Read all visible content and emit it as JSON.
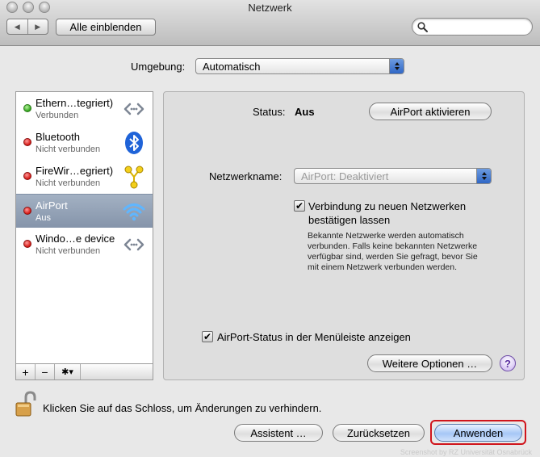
{
  "window": {
    "title": "Netzwerk"
  },
  "toolbar": {
    "back_icon": "back-arrow-icon",
    "forward_icon": "forward-arrow-icon",
    "show_all_label": "Alle einblenden",
    "search_placeholder": ""
  },
  "location": {
    "label": "Umgebung:",
    "value": "Automatisch"
  },
  "services": [
    {
      "name": "Ethern…tegriert)",
      "status": "Verbunden",
      "status_color": "#2da117",
      "icon": "ethernet-icon"
    },
    {
      "name": "Bluetooth",
      "status": "Nicht verbunden",
      "status_color": "#d3140f",
      "icon": "bluetooth-icon"
    },
    {
      "name": "FireWir…egriert)",
      "status": "Nicht verbunden",
      "status_color": "#d3140f",
      "icon": "firewire-icon"
    },
    {
      "name": "AirPort",
      "status": "Aus",
      "status_color": "#d3140f",
      "icon": "wifi-icon",
      "selected": true
    },
    {
      "name": "Windo…e device",
      "status": "Nicht verbunden",
      "status_color": "#d3140f",
      "icon": "ethernet-icon"
    }
  ],
  "listbar": {
    "add": "+",
    "remove": "−",
    "gear": "✱▾"
  },
  "detail": {
    "status_label": "Status:",
    "status_value": "Aus",
    "airport_button": "AirPort aktivieren",
    "network_name_label": "Netzwerkname:",
    "network_name_value": "AirPort: Deaktiviert",
    "confirm_checkbox_label_line1": "Verbindung zu neuen Netzwerken",
    "confirm_checkbox_label_line2": "bestätigen lassen",
    "confirm_checked": true,
    "confirm_help_line1": "Bekannte Netzwerke werden automatisch",
    "confirm_help_line2": "verbunden. Falls keine bekannten Netzwerke",
    "confirm_help_line3": "verfügbar sind, werden Sie gefragt, bevor Sie",
    "confirm_help_line4": "mit einem Netzwerk verbunden werden.",
    "menubar_checkbox_label": "AirPort-Status in der Menüleiste anzeigen",
    "menubar_checked": true,
    "more_options_button": "Weitere Optionen …",
    "help_button": "?"
  },
  "footer": {
    "lock_text": "Klicken Sie auf das Schloss, um Änderungen zu verhindern.",
    "assistant_button": "Assistent …",
    "revert_button": "Zurücksetzen",
    "apply_button": "Anwenden",
    "credit": "Screenshot by RZ Universität Osnabrück"
  },
  "colors": {
    "accent": "#3b6fd0",
    "highlight_ring": "#d0141b",
    "selection": "#8f9db1"
  }
}
